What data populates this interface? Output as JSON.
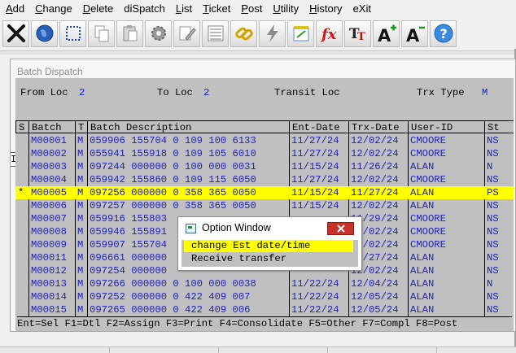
{
  "menu": [
    {
      "key": "A",
      "rest": "dd"
    },
    {
      "key": "C",
      "rest": "hange"
    },
    {
      "key": "D",
      "rest": "elete"
    },
    {
      "key": "",
      "rest": "diSpatch"
    },
    {
      "key": "L",
      "rest": "ist"
    },
    {
      "key": "T",
      "rest": "icket"
    },
    {
      "key": "P",
      "rest": "ost"
    },
    {
      "key": "U",
      "rest": "tility"
    },
    {
      "key": "H",
      "rest": "istory"
    },
    {
      "key": "",
      "rest": "eXit"
    }
  ],
  "toolbar_icons": [
    "close-x-icon",
    "globe-icon",
    "select-rect-icon",
    "copy-icon",
    "paste-icon",
    "settings-icon",
    "edit-icon",
    "list-icon",
    "chain-link-icon",
    "lightning-icon",
    "calc-icon",
    "fx-icon",
    "text-format-icon",
    "font-increase-icon",
    "font-decrease-icon",
    "help-icon"
  ],
  "window": {
    "title": "Batch Dispatch",
    "stub_char": "I",
    "header": {
      "from_label": "From Loc",
      "from_value": "2",
      "to_label": "To Loc",
      "to_value": "2",
      "transit_label": "Transit Loc",
      "trx_type_label": "Trx Type",
      "trx_type_value": "M"
    },
    "columns": [
      "S",
      "Batch",
      "T",
      "Batch Description",
      "Ent-Date",
      "Trx-Date",
      "User-ID",
      "St"
    ],
    "rows": [
      {
        "s": "",
        "batch": "M00001",
        "t": "M",
        "desc": "059906 155704 0 109 100 6133",
        "ent": "11/27/24",
        "trx": "12/02/24",
        "user": "CMOORE",
        "st": "NS"
      },
      {
        "s": "",
        "batch": "M00002",
        "t": "M",
        "desc": "055941 155918 0 109 105 6010",
        "ent": "11/27/24",
        "trx": "12/02/24",
        "user": "CMOORE",
        "st": "NS"
      },
      {
        "s": "",
        "batch": "M00003",
        "t": "M",
        "desc": "097244 000000 0 100 000 0031",
        "ent": "11/15/24",
        "trx": "11/26/24",
        "user": "ALAN",
        "st": "N"
      },
      {
        "s": "",
        "batch": "M00004",
        "t": "M",
        "desc": "059942 155860 0 109 115 6050",
        "ent": "11/27/24",
        "trx": "12/02/24",
        "user": "CMOORE",
        "st": "NS"
      },
      {
        "s": "*",
        "batch": "M00005",
        "t": "M",
        "desc": "097256 000000 0 358 365 0050",
        "ent": "11/15/24",
        "trx": "11/27/24",
        "user": "ALAN",
        "st": "PS",
        "selected": true
      },
      {
        "s": "",
        "batch": "M00006",
        "t": "M",
        "desc": "097257 000000 0 358 365 0050",
        "ent": "11/15/24",
        "trx": "12/02/24",
        "user": "ALAN",
        "st": "NS"
      },
      {
        "s": "",
        "batch": "M00007",
        "t": "M",
        "desc": "059916 155803",
        "ent": "",
        "trx": "11/29/24",
        "user": "CMOORE",
        "st": "NS"
      },
      {
        "s": "",
        "batch": "M00008",
        "t": "M",
        "desc": "059946 155891",
        "ent": "",
        "trx": "12/02/24",
        "user": "CMOORE",
        "st": "NS"
      },
      {
        "s": "",
        "batch": "M00009",
        "t": "M",
        "desc": "059907 155704",
        "ent": "",
        "trx": "12/02/24",
        "user": "CMOORE",
        "st": "NS"
      },
      {
        "s": "",
        "batch": "M00011",
        "t": "M",
        "desc": "096661 000000",
        "ent": "",
        "trx": "11/27/24",
        "user": "ALAN",
        "st": "NS"
      },
      {
        "s": "",
        "batch": "M00012",
        "t": "M",
        "desc": "097254 000000",
        "ent": "",
        "trx": "12/02/24",
        "user": "ALAN",
        "st": "NS"
      },
      {
        "s": "",
        "batch": "M00013",
        "t": "M",
        "desc": "097266 000000 0 100 000 0038",
        "ent": "11/22/24",
        "trx": "12/04/24",
        "user": "ALAN",
        "st": "N"
      },
      {
        "s": "",
        "batch": "M00014",
        "t": "M",
        "desc": "097252 000000 0 422 409 007",
        "ent": "11/22/24",
        "trx": "12/05/24",
        "user": "ALAN",
        "st": "NS"
      },
      {
        "s": "",
        "batch": "M00015",
        "t": "M",
        "desc": "097265 000000 0 422 409 006",
        "ent": "11/22/24",
        "trx": "12/05/24",
        "user": "ALAN",
        "st": "NS"
      }
    ],
    "footer": "Ent=Sel F1=Dtl F2=Assign F3=Print F4=Consolidate F5=Other F7=Compl F8=Post"
  },
  "option_window": {
    "title": "Option Window",
    "choices": [
      "change Est date/time",
      "Receive transfer"
    ],
    "selected_index": 0
  },
  "colors": {
    "highlight": "#ffff00",
    "data_text": "#1d1dbf",
    "terminal_bg": "#c0c0c0",
    "close_button": "#c7312a"
  }
}
